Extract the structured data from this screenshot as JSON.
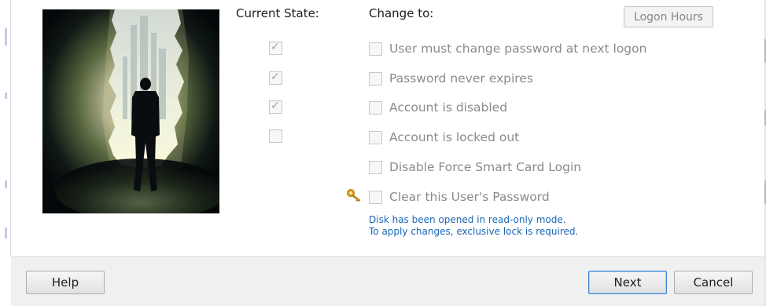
{
  "headers": {
    "current_state": "Current State:",
    "change_to": "Change to:",
    "logon_hours": "Logon Hours"
  },
  "current_state": [
    {
      "checked": true
    },
    {
      "checked": true
    },
    {
      "checked": true
    },
    {
      "checked": false
    }
  ],
  "change_options": [
    {
      "label": "User must change password at next logon",
      "checked": false
    },
    {
      "label": "Password never expires",
      "checked": false
    },
    {
      "label": "Account is disabled",
      "checked": false
    },
    {
      "label": "Account is locked out",
      "checked": false
    },
    {
      "label": "Disable Force Smart Card Login",
      "checked": false
    },
    {
      "label": "Clear this User's Password",
      "checked": false
    }
  ],
  "notice": {
    "line1": "Disk has been opened in read-only mode.",
    "line2": "To apply changes, exclusive lock is required."
  },
  "buttons": {
    "help": "Help",
    "next": "Next",
    "cancel": "Cancel"
  },
  "colors": {
    "notice_text": "#1a66b5",
    "disabled_text": "#8a8a8a",
    "default_button_border": "#3b83d4"
  },
  "icons": {
    "key": "key-icon",
    "hero": "businessman-at-glowing-doorway"
  }
}
